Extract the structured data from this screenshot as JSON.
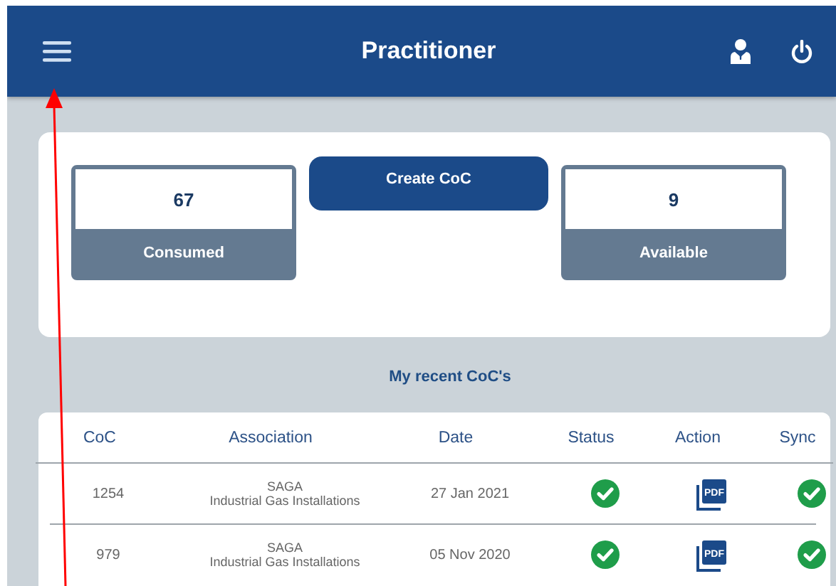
{
  "header": {
    "title": "Practitioner"
  },
  "summary": {
    "consumed": {
      "value": "67",
      "label": "Consumed"
    },
    "create_button": "Create CoC",
    "available": {
      "value": "9",
      "label": "Available"
    }
  },
  "recent": {
    "title": "My recent CoC's",
    "columns": [
      "CoC",
      "Association",
      "Date",
      "Status",
      "Action",
      "Sync"
    ],
    "rows": [
      {
        "coc": "1254",
        "association": "SAGA",
        "association_sub": "Industrial Gas Installations",
        "date": "27 Jan 2021",
        "status_ok": true,
        "action_label": "PDF",
        "synced": true
      },
      {
        "coc": "979",
        "association": "SAGA",
        "association_sub": "Industrial Gas Installations",
        "date": "05 Nov 2020",
        "status_ok": true,
        "action_label": "PDF",
        "synced": true
      }
    ]
  },
  "annotation": {
    "kind": "arrow"
  }
}
